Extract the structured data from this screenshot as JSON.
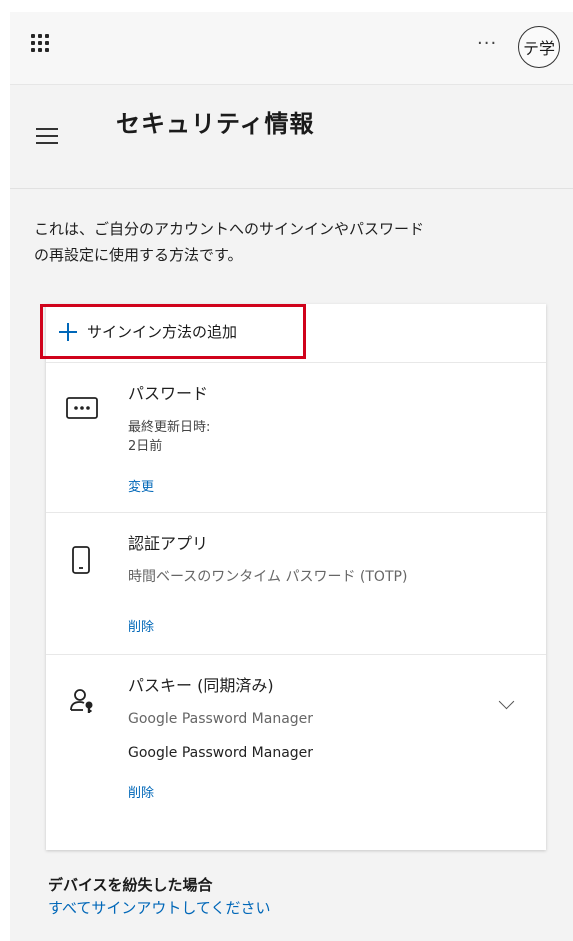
{
  "header": {
    "more_label": "···",
    "avatar_initials": "テ学"
  },
  "page": {
    "title": "セキュリティ情報",
    "description_line1": "これは、ご自分のアカウントへのサインインやパスワード",
    "description_line2": "の再設定に使用する方法です。"
  },
  "add_method": {
    "label": "サインイン方法の追加",
    "highlight_color": "#d0021b"
  },
  "methods": [
    {
      "icon": "password-dots-icon",
      "title": "パスワード",
      "detail1": "最終更新日時:",
      "detail2": "2日前",
      "action": "変更"
    },
    {
      "icon": "phone-icon",
      "title": "認証アプリ",
      "detail1": "時間ベースのワンタイム パスワード (TOTP)",
      "action": "削除"
    },
    {
      "icon": "passkey-icon",
      "title": "パスキー (同期済み)",
      "detail1": "Google Password Manager",
      "detail2": "Google Password Manager",
      "action": "削除"
    }
  ],
  "lost_device": {
    "title": "デバイスを紛失した場合",
    "link": "すべてサインアウトしてください"
  },
  "colors": {
    "link": "#0067b8",
    "background": "#f3f3f3"
  }
}
